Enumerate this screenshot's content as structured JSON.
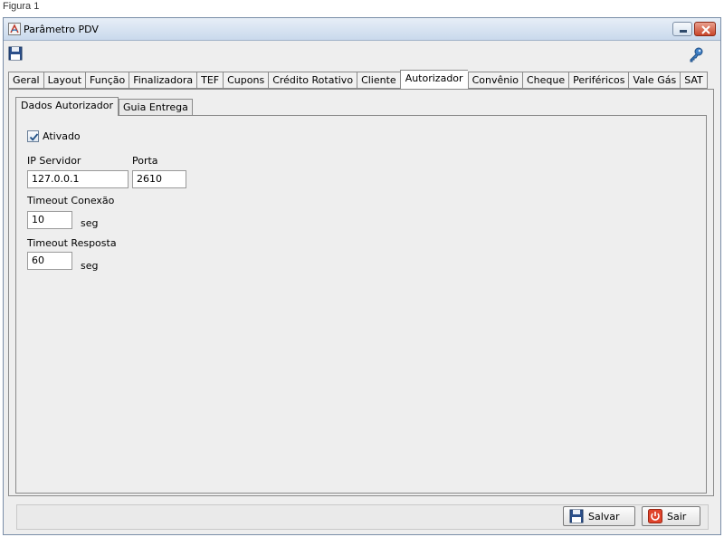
{
  "caption": "Figura 1",
  "window": {
    "title": "Parâmetro PDV"
  },
  "main_tabs": [
    {
      "label": "Geral"
    },
    {
      "label": "Layout"
    },
    {
      "label": "Função"
    },
    {
      "label": "Finalizadora"
    },
    {
      "label": "TEF"
    },
    {
      "label": "Cupons"
    },
    {
      "label": "Crédito Rotativo"
    },
    {
      "label": "Cliente"
    },
    {
      "label": "Autorizador",
      "active": true
    },
    {
      "label": "Convênio"
    },
    {
      "label": "Cheque"
    },
    {
      "label": "Periféricos"
    },
    {
      "label": "Vale Gás"
    },
    {
      "label": "SAT"
    }
  ],
  "sub_tabs": [
    {
      "label": "Dados Autorizador",
      "active": true
    },
    {
      "label": "Guia Entrega"
    }
  ],
  "form": {
    "ativado_label": "Ativado",
    "ativado_checked": true,
    "ip_servidor_label": "IP Servidor",
    "ip_servidor_value": "127.0.0.1",
    "porta_label": "Porta",
    "porta_value": "2610",
    "timeout_conexao_label": "Timeout Conexão",
    "timeout_conexao_value": "10",
    "timeout_conexao_unit": "seg",
    "timeout_resposta_label": "Timeout Resposta",
    "timeout_resposta_value": "60",
    "timeout_resposta_unit": "seg"
  },
  "buttons": {
    "salvar_label": "Salvar",
    "sair_label": "Sair"
  },
  "icons": {
    "title": "java-app-icon",
    "save": "floppy-disk-icon",
    "key": "key-icon",
    "minimize": "minimize-icon",
    "close": "close-icon"
  },
  "colors": {
    "titlebar": "#c9d9ec",
    "close_button": "#c9452a",
    "sair_icon": "#e0442c"
  }
}
